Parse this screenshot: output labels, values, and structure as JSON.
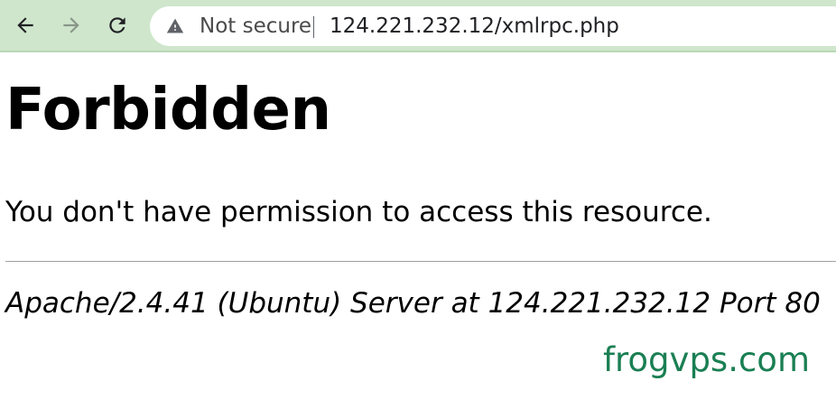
{
  "browser": {
    "back_icon": "arrow-left-icon",
    "forward_icon": "arrow-right-icon",
    "reload_icon": "reload-icon",
    "security_icon": "warning-triangle-icon",
    "security_label": "Not secure",
    "url": "124.221.232.12/xmlrpc.php",
    "toolbar_color": "#cfe6cc"
  },
  "page": {
    "title": "Forbidden",
    "message": "You don't have permission to access this resource.",
    "server_signature": "Apache/2.4.41 (Ubuntu) Server at 124.221.232.12 Port 80"
  },
  "watermark": {
    "text": "frogvps.com",
    "color": "#1a7f53"
  }
}
